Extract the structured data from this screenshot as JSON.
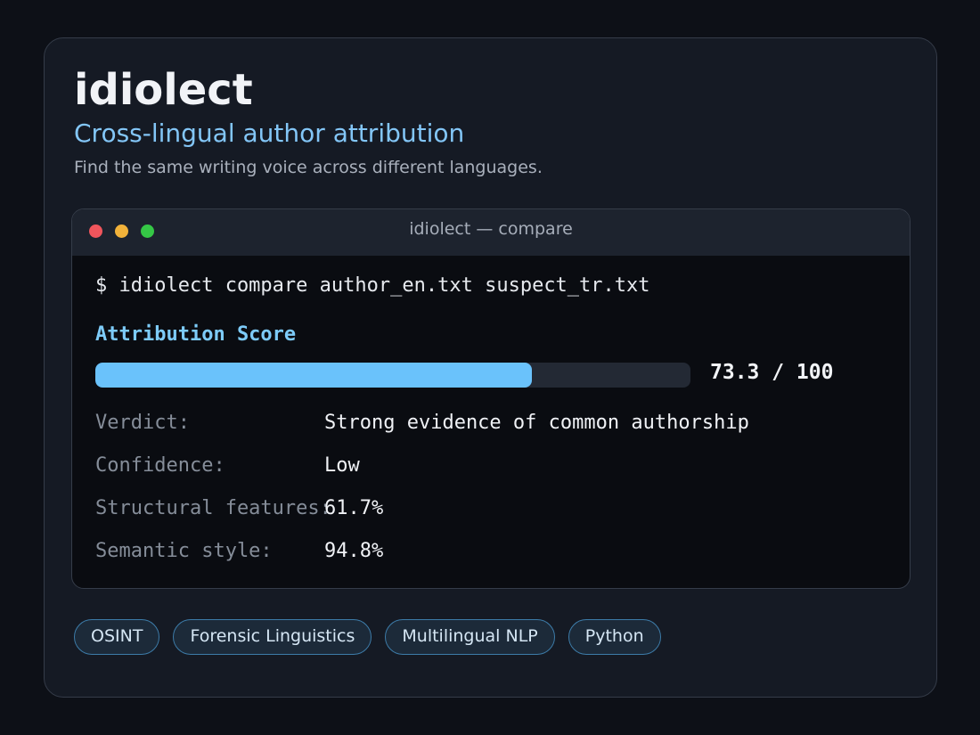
{
  "header": {
    "title": "idiolect",
    "subtitle": "Cross-lingual author attribution",
    "tagline": "Find the same writing voice across different languages."
  },
  "terminal": {
    "window_title": "idiolect — compare",
    "traffic_lights": [
      "#f0555c",
      "#f2b23a",
      "#35c746"
    ],
    "command": "$ idiolect compare author_en.txt suspect_tr.txt",
    "score_label": "Attribution Score",
    "score": 73.3,
    "score_max": 100,
    "score_text": "73.3 / 100",
    "metrics": [
      {
        "label": "Verdict:",
        "value": "Strong evidence of common authorship"
      },
      {
        "label": "Confidence:",
        "value": "Low"
      },
      {
        "label": "Structural features:",
        "value": "61.7%"
      },
      {
        "label": "Semantic style:",
        "value": "94.8%"
      }
    ]
  },
  "tags": [
    "OSINT",
    "Forensic Linguistics",
    "Multilingual NLP",
    "Python"
  ],
  "colors": {
    "accent": "#6ac2fb",
    "subtitle": "#83c6f7",
    "card_background": "#151a24",
    "terminal_background": "#0a0c11"
  }
}
